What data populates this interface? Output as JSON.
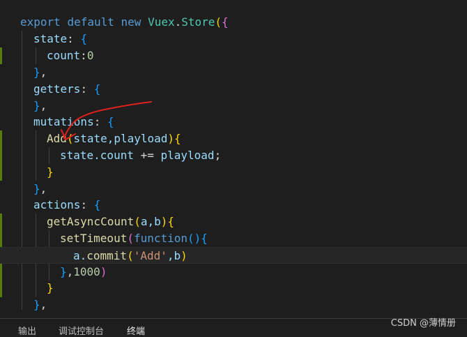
{
  "code": {
    "l1": {
      "a": "export",
      "b": "default",
      "c": "new",
      "d": "Vuex",
      "e": ".",
      "f": "Store",
      "g": "(",
      "h": "{"
    },
    "l2": {
      "a": "state",
      ":": ":",
      "b": "{"
    },
    "l3": {
      "a": "count",
      "b": ":",
      "c": "0"
    },
    "l4": {
      "a": "}",
      "b": ","
    },
    "l5": {
      "a": "getters",
      "b": ":",
      "c": "{"
    },
    "l6": {
      "a": "}",
      "b": ","
    },
    "l7": {
      "a": "mutations",
      "b": ":",
      "c": "{"
    },
    "l8": {
      "a": "Add",
      "b": "(",
      "c": "state,playload",
      "d": ")",
      "e": "{"
    },
    "l9": {
      "a": "state.count",
      "b": " += ",
      "c": "playload",
      "d": ";"
    },
    "l10": {
      "a": "}"
    },
    "l11": {
      "a": "}",
      "b": ","
    },
    "l12": {
      "a": "actions",
      "b": ":",
      "c": "{"
    },
    "l13": {
      "a": "getAsyncCount",
      "b": "(",
      "c": "a,b",
      "d": ")",
      "e": "{"
    },
    "l14": {
      "a": "setTimeout",
      "b": "(",
      "c": "function",
      "d": "()",
      "e": "{"
    },
    "l15": {
      "a": "a.",
      "b": "commit",
      "c": "(",
      "d": "'Add'",
      "e": ",b",
      "f": ")"
    },
    "l16": {
      "a": "}",
      "b": ",",
      "c": "1000",
      "d": ")"
    },
    "l17": {
      "a": "}"
    },
    "l18": {
      "a": "}",
      "b": ","
    }
  },
  "panel": {
    "tabs": [
      "输出",
      "调试控制台",
      "终端"
    ],
    "active_tab": "终端"
  },
  "watermark": "CSDN @薄情册",
  "colors": {
    "background": "#1e1e1e",
    "keyword": "#569cd6",
    "class": "#4ec9b0",
    "function": "#dcdcaa",
    "property": "#9cdcfe",
    "number": "#b5cea8",
    "string": "#ce9178",
    "gutter_modified": "#587c0c",
    "annotation_ink": "#e0201c"
  }
}
